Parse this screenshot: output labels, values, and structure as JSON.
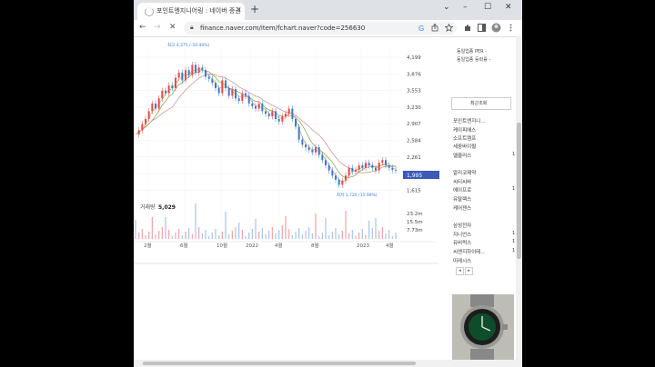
{
  "browser": {
    "tab_title": "포인트엔지니어링 : 네이버 증권",
    "tab_close": "×",
    "new_tab": "+",
    "url": "finance.naver.com/item/fchart.naver?code=256630",
    "window_controls": [
      "⌄",
      "–",
      "☐",
      "✕"
    ],
    "nav": {
      "back": "←",
      "forward": "→",
      "reload": "✕"
    }
  },
  "chart_data": {
    "type": "line",
    "title": "",
    "price_ticks": [
      "4,199",
      "3,876",
      "3,553",
      "3,230",
      "2,907",
      "2,584",
      "2,261",
      "1,938",
      "1,615"
    ],
    "current_price": "1,995",
    "high_label": "최고 4,375 (-54.40%)",
    "low_label": "최저 1,720 (15.99%)",
    "volume_label": "거래량",
    "volume_value": "5,029",
    "volume_ticks": [
      "23.2m",
      "15.5m",
      "7.73m"
    ],
    "x_ticks": [
      "2월",
      "6월",
      "10월",
      "2022",
      "4월",
      "8월",
      "2023",
      "4월"
    ],
    "colors": {
      "up": "#e8474f",
      "down": "#3a7bd5",
      "ma5": "#e3a84a",
      "ma20": "#7b9f4a",
      "ma60": "#c98b8b",
      "price_tag": "#3c5ab8"
    },
    "price": [
      2700,
      2780,
      2900,
      3000,
      3150,
      3300,
      3200,
      3400,
      3550,
      3500,
      3650,
      3600,
      3800,
      3900,
      3750,
      3950,
      3850,
      4050,
      3900,
      4000,
      3950,
      3820,
      3780,
      3700,
      3600,
      3500,
      3750,
      3600,
      3450,
      3580,
      3400,
      3350,
      3500,
      3450,
      3300,
      3250,
      3200,
      3300,
      3150,
      3100,
      3050,
      3150,
      3000,
      2950,
      3050,
      3100,
      3200,
      3000,
      2850,
      2600,
      2500,
      2450,
      2400,
      2350,
      2450,
      2300,
      2200,
      2100,
      2000,
      1900,
      1820,
      1720,
      1800,
      1900,
      2050,
      1980,
      2010,
      2100,
      2050,
      2150,
      2100,
      2050,
      2000,
      2150,
      2200,
      2100,
      2050,
      2010,
      1995
    ]
  },
  "sidebar": {
    "top_lines": [
      "동일업종 PER -",
      "동일업종 등락률 -"
    ],
    "recent_title": "최근조회",
    "recent_items": [
      "포인트엔지니...",
      "케이피에스",
      "소프트캠프",
      "세중바이럴",
      "엘클러스",
      "알리코제약",
      "씨티씨바",
      "에이프로",
      "유탈렉스",
      "케어젠스",
      "삼성전자",
      "지니언스",
      "유비럭스",
      "씨엔지하이테...",
      "미래시스"
    ],
    "recent_numbers": [
      "",
      "",
      "",
      "",
      "1",
      "",
      "",
      "1",
      "",
      "",
      "",
      "1",
      "1",
      "1",
      ""
    ],
    "pager": [
      "◂",
      "▸"
    ]
  }
}
